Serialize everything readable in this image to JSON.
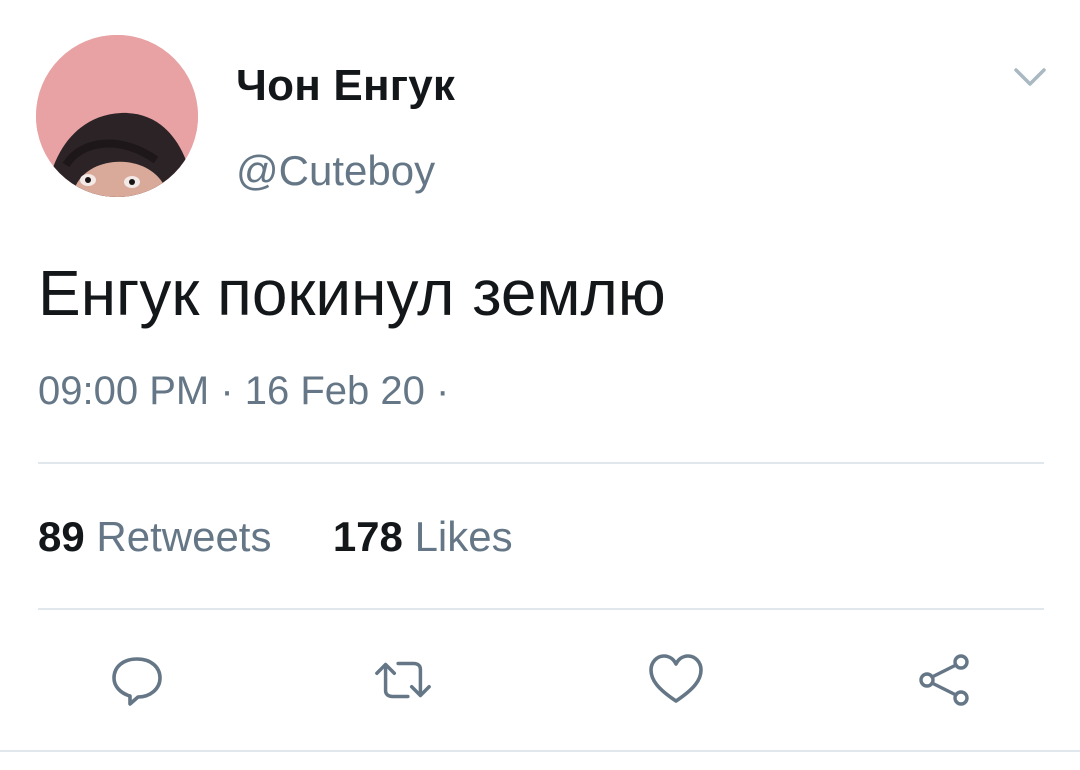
{
  "user": {
    "display_name": "Чон Енгук",
    "handle": "@Cuteboy",
    "avatar_icon": "avatar-photo"
  },
  "tweet": {
    "text": "Енгук покинул землю",
    "meta": "09:00 PM · 16 Feb 20 ·"
  },
  "stats": {
    "retweets_count": "89",
    "retweets_label": "Retweets",
    "likes_count": "178",
    "likes_label": "Likes"
  },
  "actions": {
    "reply_icon": "reply-icon",
    "retweet_icon": "retweet-icon",
    "like_icon": "heart-icon",
    "share_icon": "share-icon"
  },
  "colors": {
    "text_primary": "#14171a",
    "text_secondary": "#657786",
    "divider": "#e1e8ed",
    "icon": "#657786"
  }
}
